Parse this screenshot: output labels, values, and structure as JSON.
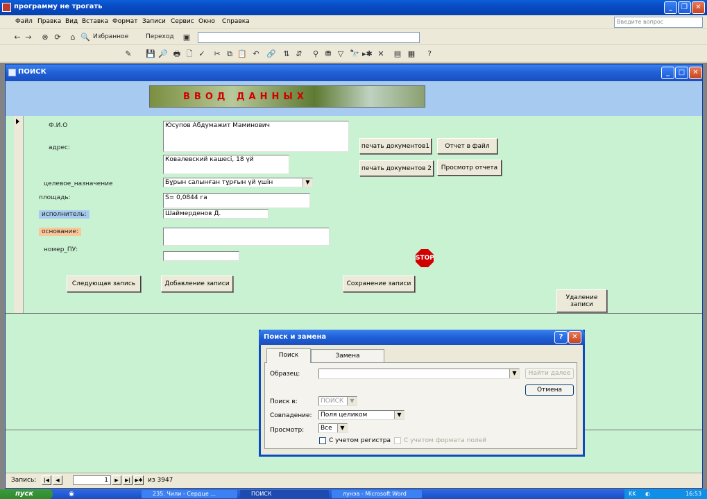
{
  "app": {
    "title": "программу не трогать"
  },
  "menu": {
    "items": [
      "Файл",
      "Правка",
      "Вид",
      "Вставка",
      "Формат",
      "Записи",
      "Сервис",
      "Окно",
      "Справка"
    ],
    "ask_placeholder": "Введите вопрос"
  },
  "webbar": {
    "favorites": "Избранное",
    "go": "Переход"
  },
  "form": {
    "window_title": "ПОИСК",
    "banner": "ВВОД ДАННЫХ",
    "labels": {
      "fio": "Ф.И.О",
      "address": "адрес:",
      "purpose": "целевое_назначение",
      "area": "площадь:",
      "executor": "исполнитель:",
      "basis": "основание:",
      "pu_number": "номер_ПУ:"
    },
    "values": {
      "fio": "Юсупов Абдумажит Маминович",
      "address": "Ковалевский кашесі, 18 үй",
      "purpose": "Бұрын салынған тұрғын үй үшін",
      "area": "S= 0,0844 га",
      "executor": "Шаймерденов Д.",
      "basis": "",
      "pu_number": ""
    },
    "buttons": {
      "print1": "печать документов1",
      "print2": "печать документов 2",
      "report_file": "Отчет в файл",
      "report_view": "Просмотр отчета",
      "next": "Следующая запись",
      "add": "Добавление записи",
      "save": "Сохранение записи",
      "delete_line1": "Удаление",
      "delete_line2": "записи",
      "stop": "STOP"
    }
  },
  "nav": {
    "label": "Запись:",
    "current": "1",
    "of": "из 3947"
  },
  "dialog": {
    "title": "Поиск и замена",
    "tabs": [
      "Поиск",
      "Замена"
    ],
    "pattern_label": "Образец:",
    "pattern_value": "",
    "find_next": "Найти далее",
    "cancel": "Отмена",
    "search_in_label": "Поиск в:",
    "search_in_value": "ПОИСК",
    "match_label": "Совпадение:",
    "match_value": "Поля целиком",
    "view_label": "Просмотр:",
    "view_value": "Все",
    "case_label": "С учетом регистра",
    "format_label": "С учетом формата полей"
  },
  "taskbar": {
    "start": "пуск",
    "tasks": [
      "235. Чили - Сердце ...",
      "ПОИСК",
      "лунэа - Microsoft Word"
    ],
    "lang": "KK",
    "time": "16:53"
  }
}
